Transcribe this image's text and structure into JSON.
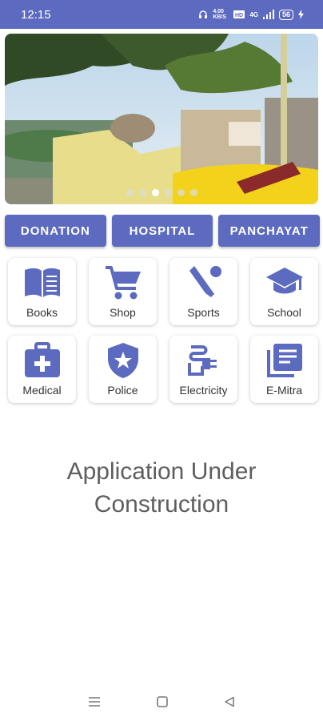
{
  "status_bar": {
    "time": "12:15",
    "net_speed": "4.00 KB/S",
    "network": "4G",
    "battery": "56",
    "icons": [
      "headphones-icon",
      "hd-icon",
      "signal-icon",
      "battery-icon",
      "charging-icon"
    ],
    "background": "#5c6bc0"
  },
  "banner": {
    "slide_count": 6,
    "active_slide": 3
  },
  "buttons": {
    "donation": "DONATION",
    "hospital": "HOSPITAL",
    "panchayat": "PANCHAYAT"
  },
  "categories": [
    {
      "label": "Books",
      "icon": "book-icon"
    },
    {
      "label": "Shop",
      "icon": "cart-icon"
    },
    {
      "label": "Sports",
      "icon": "cricket-icon"
    },
    {
      "label": "School",
      "icon": "school-icon"
    },
    {
      "label": "Medical",
      "icon": "medical-kit-icon"
    },
    {
      "label": "Police",
      "icon": "police-badge-icon"
    },
    {
      "label": "Electricity",
      "icon": "plug-icon"
    },
    {
      "label": "E-Mitra",
      "icon": "library-icon"
    }
  ],
  "message": {
    "line1": "Application Under",
    "line2": "Construction"
  },
  "colors": {
    "accent": "#5c6bc0",
    "text": "#5f5f5f"
  }
}
